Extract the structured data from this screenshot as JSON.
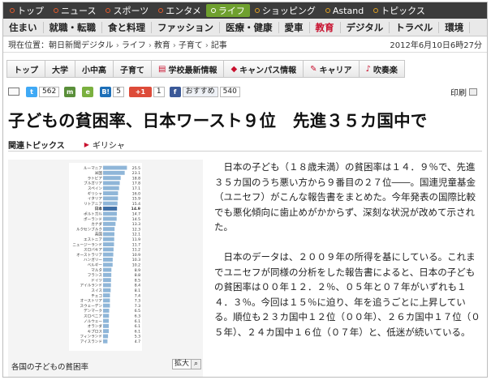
{
  "global_nav": {
    "items": [
      {
        "label": "トップ",
        "style": "red"
      },
      {
        "label": "ニュース",
        "style": "red"
      },
      {
        "label": "スポーツ",
        "style": "red"
      },
      {
        "label": "エンタメ",
        "style": "red"
      },
      {
        "label": "ライフ",
        "style": "active"
      },
      {
        "label": "ショッピング",
        "style": "gold"
      },
      {
        "label": "Astand",
        "style": "gold"
      },
      {
        "label": "トピックス",
        "style": "gold"
      }
    ]
  },
  "sub_nav": {
    "items": [
      {
        "label": "住まい",
        "active": false
      },
      {
        "label": "就職・転職",
        "active": false
      },
      {
        "label": "食と料理",
        "active": false
      },
      {
        "label": "ファッション",
        "active": false
      },
      {
        "label": "医療・健康",
        "active": false
      },
      {
        "label": "愛車",
        "active": false
      },
      {
        "label": "教育",
        "active": true
      },
      {
        "label": "デジタル",
        "active": false
      },
      {
        "label": "トラベル",
        "active": false
      },
      {
        "label": "環境",
        "active": false
      }
    ]
  },
  "breadcrumb": {
    "prefix": "現在位置：",
    "items": [
      "朝日新聞デジタル",
      "ライフ",
      "教育",
      "子育て",
      "記事"
    ],
    "date": "2012年6月10日6時27分"
  },
  "section_tabs": [
    {
      "label": "トップ",
      "icon": ""
    },
    {
      "label": "大学",
      "icon": ""
    },
    {
      "label": "小中高",
      "icon": ""
    },
    {
      "label": "子育て",
      "icon": ""
    },
    {
      "label": "学校最新情報",
      "icon": "school-icon"
    },
    {
      "label": "キャンパス情報",
      "icon": "cap-icon"
    },
    {
      "label": "キャリア",
      "icon": "pencil-icon"
    },
    {
      "label": "吹奏楽",
      "icon": "horn-icon"
    }
  ],
  "share": {
    "twitter_count": "562",
    "hatena_count": "5",
    "gplus_label": "+1",
    "gplus_count": "1",
    "fb_label": "おすすめ",
    "fb_count": "540",
    "print_label": "印刷"
  },
  "article": {
    "headline": "子どもの貧困率、日本ワースト９位　先進３５カ国中で",
    "related_label": "関連トピックス",
    "related_topic": "ギリシャ",
    "paragraphs": [
      "日本の子ども（１８歳未満）の貧困率は１４．９％で、先進３５カ国のうち悪い方から９番目の２７位――。国連児童基金（ユニセフ）がこんな報告書をまとめた。今年発表の国際比較でも悪化傾向に歯止めがかからず、深刻な状況が改めて示された。",
      "日本のデータは、２００９年の所得を基にしている。これまでユニセフが同様の分析をした報告書によると、日本の子どもの貧困率は００年１２．２％、０５年と０７年がいずれも１４．３％。今回は１５％に迫り、年を追うごとに上昇している。順位も２３カ国中１２位（００年）、２６カ国中１７位（０５年）、２４カ国中１６位（０７年）と、低迷が続いている。"
    ],
    "figure_caption": "各国の子どもの貧困率",
    "zoom_label": "拡大"
  },
  "chart_data": {
    "type": "bar",
    "orientation": "horizontal",
    "title": "各国の子どもの貧困率",
    "categories": [
      "ルーマニア",
      "米国",
      "ラトビア",
      "ブルガリア",
      "スペイン",
      "ギリシャ",
      "イタリア",
      "リトアニア",
      "日本",
      "ポルトガル",
      "ポーランド",
      "カナダ",
      "ルクセンブルク",
      "英国",
      "エストニア",
      "ニュージーランド",
      "スロバキア",
      "オーストラリア",
      "ハンガリー",
      "ベルギー",
      "マルタ",
      "フランス",
      "ドイツ",
      "アイルランド",
      "スイス",
      "チェコ",
      "オーストリア",
      "スウェーデン",
      "デンマーク",
      "スロベニア",
      "ノルウェー",
      "オランダ",
      "キプロス",
      "フィンランド",
      "アイスランド"
    ],
    "values": [
      25.5,
      23.1,
      18.8,
      17.8,
      17.1,
      16.0,
      15.9,
      15.4,
      14.9,
      14.7,
      14.5,
      13.3,
      12.3,
      12.1,
      11.9,
      11.7,
      11.2,
      10.9,
      10.3,
      10.2,
      8.9,
      8.8,
      8.5,
      8.4,
      8.1,
      7.4,
      7.3,
      7.3,
      6.5,
      6.3,
      6.1,
      6.1,
      6.1,
      5.3,
      4.7
    ],
    "highlight": "日本",
    "bar_color": "#8fb6d8",
    "highlight_color": "#3f6fa6"
  }
}
